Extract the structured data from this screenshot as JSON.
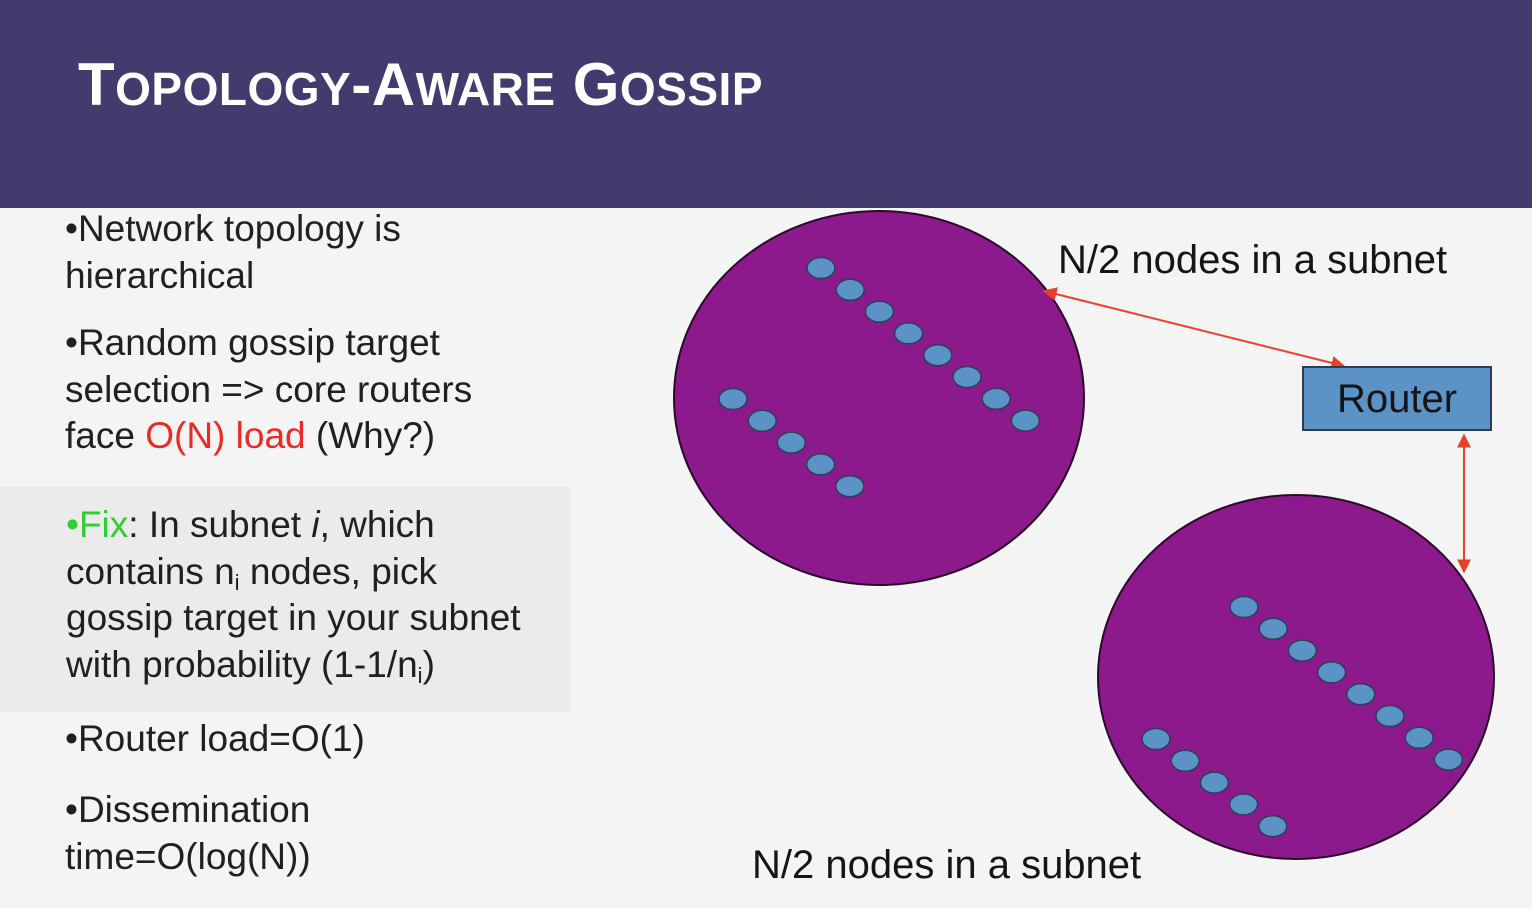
{
  "slide": {
    "title_parts": [
      "T",
      "OPOLOGY",
      "-A",
      "WARE",
      " G",
      "OSSIP"
    ]
  },
  "bullets": {
    "b1": {
      "line1": "•Network topology is",
      "line2": "hierarchical"
    },
    "b2": {
      "line1": "•Random gossip target",
      "line2": "selection => core routers",
      "line3_pre": "face ",
      "line3_red": "O(N) load",
      "line3_post": " (Why?)"
    },
    "b3": {
      "fix_label": "•Fix",
      "line1_a": ": In subnet ",
      "line1_i": "i",
      "line1_b": ", which",
      "line2_a": "contains n",
      "line2_sub": "i",
      "line2_b": " nodes, pick",
      "line3": "gossip target in your subnet",
      "line4_a": "with probability (1-1/n",
      "line4_sub": "i",
      "line4_b": ")"
    },
    "b4": {
      "text": "•Router load=O(1)"
    },
    "b5": {
      "line1": "•Dissemination",
      "line2": "time=O(log(N))"
    }
  },
  "diagram": {
    "top_subnet_label": "N/2 nodes in a subnet",
    "bottom_subnet_label": "N/2 nodes in a subnet",
    "router_label": "Router",
    "colors": {
      "subnet": "#8c1a8c",
      "node": "#5b93c6",
      "arrow": "#e8402a",
      "header": "#433a6e"
    }
  }
}
